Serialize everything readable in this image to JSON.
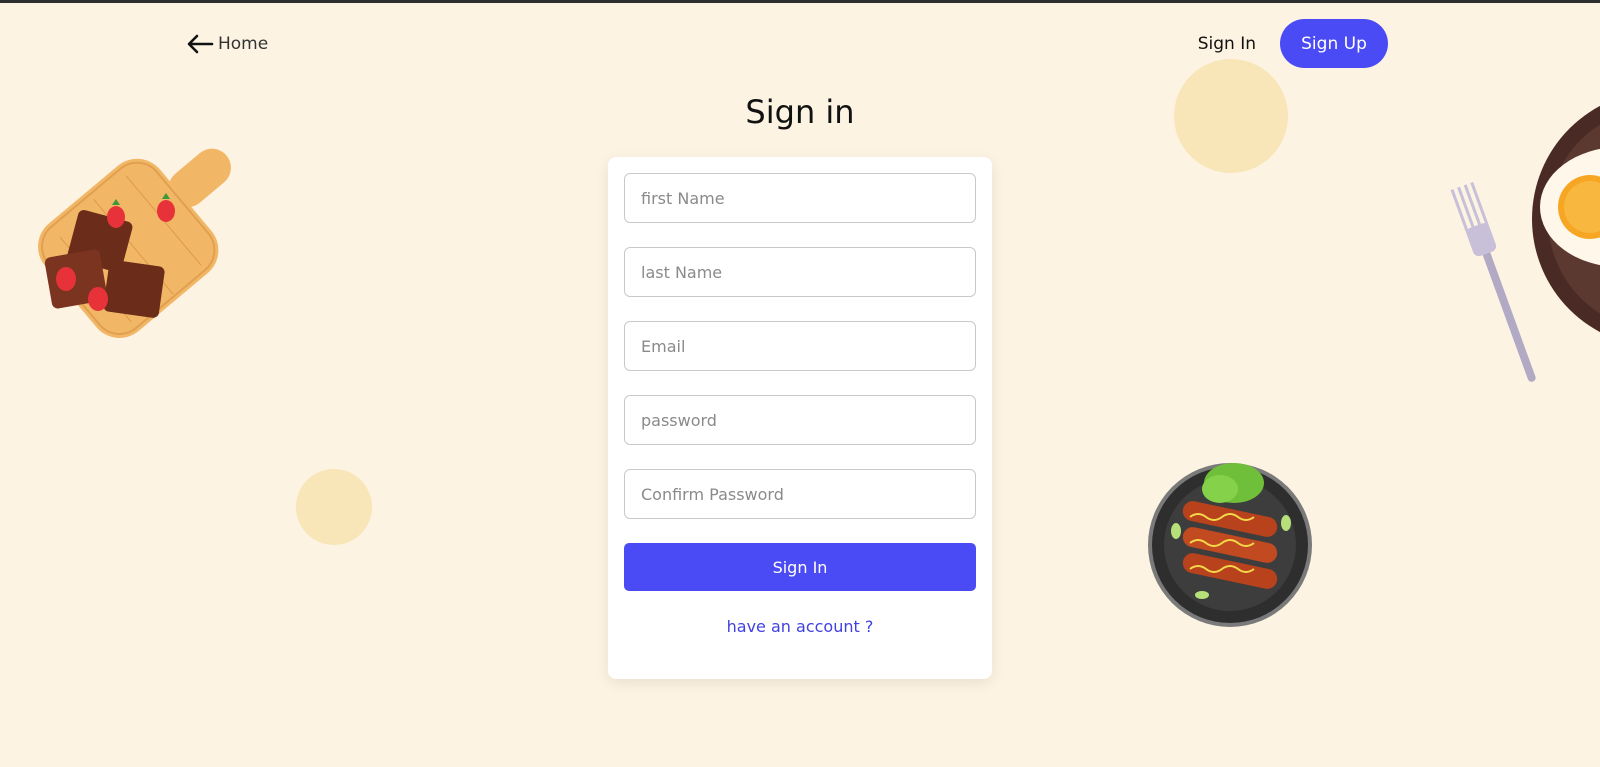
{
  "nav": {
    "home_label": "Home",
    "signin_label": "Sign In",
    "signup_label": "Sign Up"
  },
  "page_title": "Sign in",
  "form": {
    "first_name_placeholder": "first Name",
    "last_name_placeholder": "last Name",
    "email_placeholder": "Email",
    "password_placeholder": "password",
    "confirm_password_placeholder": "Confirm Password",
    "submit_label": "Sign In",
    "alt_link_label": "have an account ?"
  },
  "colors": {
    "background": "#fcf3e2",
    "accent": "#4b4bf5",
    "circle": "#f8e6b8"
  },
  "icons": {
    "back": "arrow-left-icon"
  }
}
